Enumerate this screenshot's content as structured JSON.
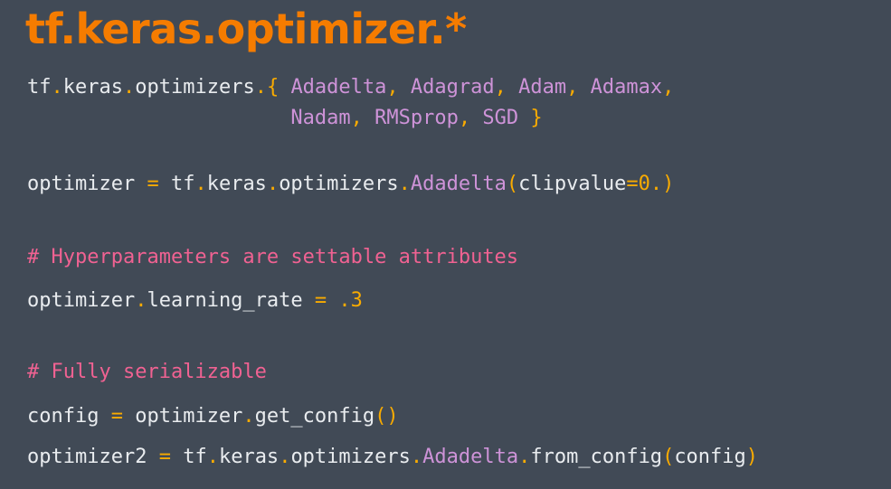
{
  "title": "tf.keras.optimizer.*",
  "code": {
    "line1": {
      "t0": "tf",
      "t1": ".",
      "t2": "keras",
      "t3": ".",
      "t4": "optimizers",
      "t5": ".",
      "t6": "{ ",
      "t7": "Adadelta",
      "t8": ", ",
      "t9": "Adagrad",
      "t10": ", ",
      "t11": "Adam",
      "t12": ", ",
      "t13": "Adamax",
      "t14": ","
    },
    "line2": {
      "indent": "                      ",
      "t0": "Nadam",
      "t1": ", ",
      "t2": "RMSprop",
      "t3": ", ",
      "t4": "SGD",
      "t5": " }"
    },
    "line3": {
      "t0": "optimizer ",
      "t1": "=",
      "t2": " tf",
      "t3": ".",
      "t4": "keras",
      "t5": ".",
      "t6": "optimizers",
      "t7": ".",
      "t8": "Adadelta",
      "t9": "(",
      "t10": "clipvalue",
      "t11": "=0.",
      "t12": ")"
    },
    "comment1": "# Hyperparameters are settable attributes",
    "line4": {
      "t0": "optimizer",
      "t1": ".",
      "t2": "learning_rate ",
      "t3": "= .3"
    },
    "comment2": "# Fully serializable",
    "line5": {
      "t0": "config ",
      "t1": "=",
      "t2": " optimizer",
      "t3": ".",
      "t4": "get_config",
      "t5": "()"
    },
    "line6": {
      "t0": "optimizer2 ",
      "t1": "=",
      "t2": " tf",
      "t3": ".",
      "t4": "keras",
      "t5": ".",
      "t6": "optimizers",
      "t7": ".",
      "t8": "Adadelta",
      "t9": ".",
      "t10": "from_config",
      "t11": "(",
      "t12": "config",
      "t13": ")"
    },
    "colors": {
      "background": "#414a56",
      "title": "#f57c00",
      "text": "#e9ecef",
      "punctuation": "#f9ab00",
      "class_name": "#ce93d8",
      "comment": "#f06292"
    }
  }
}
